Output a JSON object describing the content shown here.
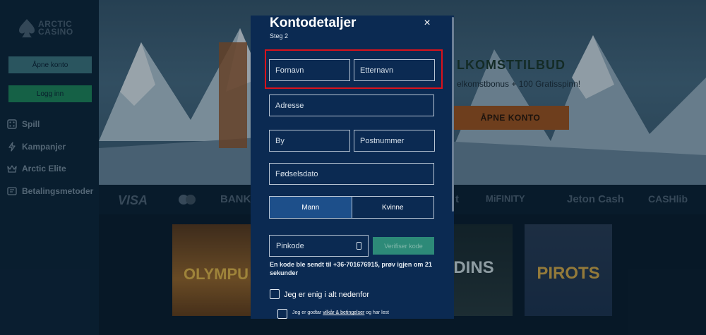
{
  "brand": {
    "line1": "ARCTIC",
    "line2": "CASINO"
  },
  "sidebar": {
    "open_account": "Åpne konto",
    "login": "Logg inn",
    "items": [
      {
        "label": "Spill",
        "icon": "dice-icon"
      },
      {
        "label": "Kampanjer",
        "icon": "lightning-icon"
      },
      {
        "label": "Arctic Elite",
        "icon": "crown-icon"
      },
      {
        "label": "Betalingsmetoder",
        "icon": "wallet-icon"
      }
    ]
  },
  "hero": {
    "title": "LKOMSTTILBUD",
    "subtitle": "elkomstbonus + 100 Gratisspinn!",
    "cta": "ÅPNE KONTO"
  },
  "payments": [
    "VISA",
    "BANK",
    "t",
    "MiFINITY",
    "Jeton Cash",
    "CASHlib"
  ],
  "games": [
    "OLYMPU",
    "DINS",
    "PIROTS"
  ],
  "modal": {
    "title": "Kontodetaljer",
    "step": "Steg 2",
    "close": "×",
    "first_name": "Fornavn",
    "last_name": "Etternavn",
    "address": "Adresse",
    "city": "By",
    "postcode": "Postnummer",
    "dob": "Fødselsdato",
    "gender": {
      "male": "Mann",
      "female": "Kvinne",
      "selected": "Mann"
    },
    "pin_placeholder": "Pinkode",
    "verify": "Verifiser kode",
    "code_message": "En kode ble sendt til +36-701676915, prøv igjen om 21 sekunder",
    "agree_all": "Jeg er enig i alt nedenfor",
    "terms_prefix": "Jeg er godtar ",
    "terms_link": "vilkår & betingelser",
    "terms_suffix": " og har lest"
  }
}
